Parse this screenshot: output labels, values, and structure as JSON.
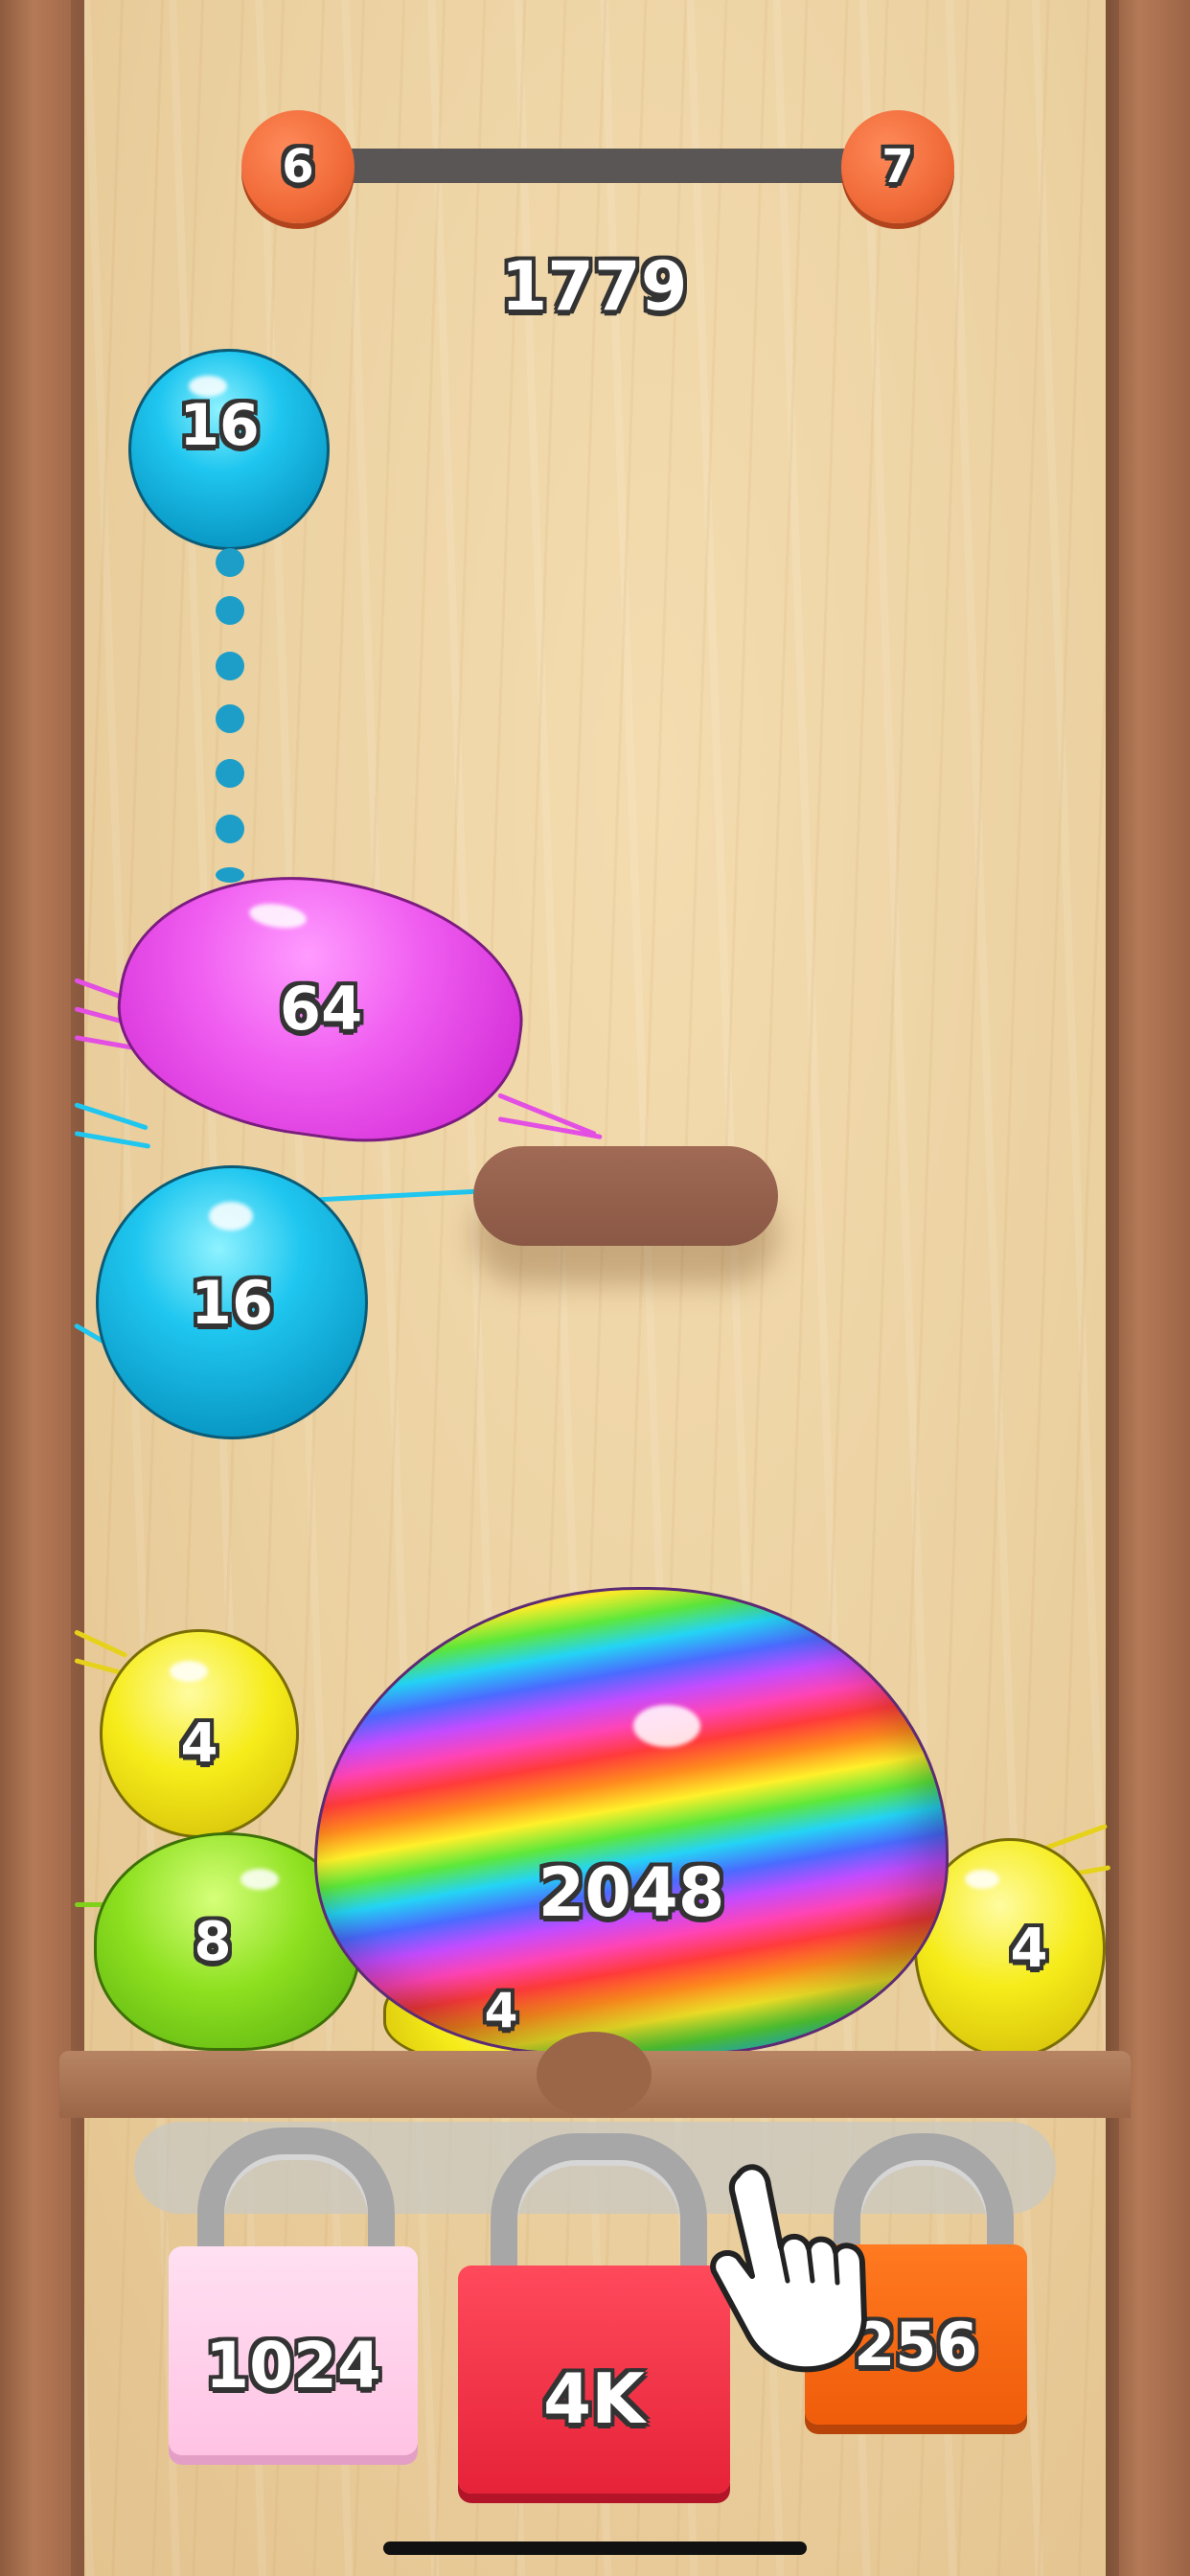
{
  "level": {
    "current": "6",
    "next": "7"
  },
  "score": "1779",
  "next_ball": {
    "value": "16",
    "color": "#1fc6ef"
  },
  "balls": [
    {
      "id": "magenta-64",
      "value": "64",
      "color": "#f05ef0"
    },
    {
      "id": "cyan-16",
      "value": "16",
      "color": "#1fc6ef"
    },
    {
      "id": "yellow-4-left",
      "value": "4",
      "color": "#f6ec1a"
    },
    {
      "id": "green-8",
      "value": "8",
      "color": "#8de01f"
    },
    {
      "id": "yellow-4-bottom",
      "value": "4",
      "color": "#f6ec1a"
    },
    {
      "id": "rainbow-2048",
      "value": "2048",
      "color": "rainbow"
    },
    {
      "id": "yellow-4-right",
      "value": "4",
      "color": "#f6ec1a"
    }
  ],
  "locks": [
    {
      "value": "1024",
      "color": "#ffcbe8"
    },
    {
      "value": "4K",
      "color": "#f0304a"
    },
    {
      "value": "256",
      "color": "#ff6a12"
    }
  ],
  "icons": [
    "drop-guide-dots",
    "pointing-hand-icon",
    "padlock-icon"
  ]
}
